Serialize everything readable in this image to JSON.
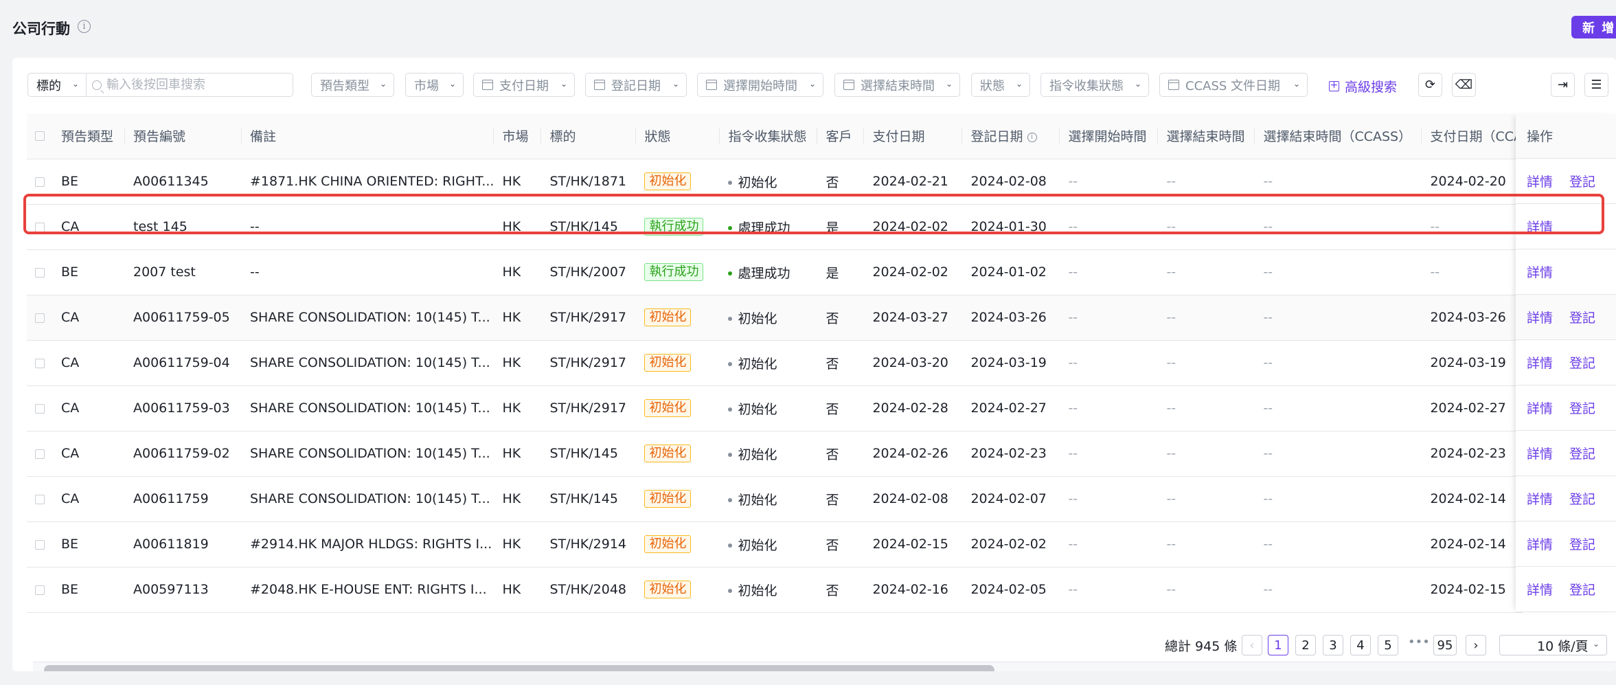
{
  "header": {
    "title": "公司行動",
    "new_button": "新 增"
  },
  "filters": {
    "target_select": "標的",
    "search_placeholder": "輸入後按回車搜索",
    "announce_type": "預告類型",
    "market": "市場",
    "pay_date": "支付日期",
    "record_date": "登記日期",
    "select_start": "選擇開始時間",
    "select_end": "選擇結束時間",
    "status": "狀態",
    "cmd_status": "指令收集狀態",
    "ccass_date": "CCASS 文件日期",
    "advanced_search": "高級搜索"
  },
  "table": {
    "headers": {
      "type": "預告類型",
      "code": "預告編號",
      "remark": "備註",
      "market": "市場",
      "target": "標的",
      "status": "狀態",
      "cmd_status": "指令收集狀態",
      "client": "客戶",
      "pay_date": "支付日期",
      "record_date": "登記日期",
      "select_start": "選擇開始時間",
      "select_end": "選擇結束時間",
      "select_end_ccass": "選擇結束時間（CCASS）",
      "pay_date2": "支付日期（CCA",
      "ops": "操作"
    },
    "rows": [
      {
        "type": "BE",
        "code": "A00611345",
        "remark": "#1871.HK CHINA ORIENTED: RIGHT...",
        "market": "HK",
        "target": "ST/HK/1871",
        "status": "初始化",
        "cmd": "初始化",
        "client": "否",
        "pay": "2024-02-21",
        "record": "2024-02-08",
        "start": "--",
        "end": "--",
        "end_ccass": "--",
        "pay2": "2024-02-20",
        "op1": "詳情",
        "op2": "登記"
      },
      {
        "type": "CA",
        "code": "test 145",
        "remark": "--",
        "market": "HK",
        "target": "ST/HK/145",
        "status": "執行成功",
        "cmd": "處理成功",
        "client": "是",
        "pay": "2024-02-02",
        "record": "2024-01-30",
        "start": "--",
        "end": "--",
        "end_ccass": "--",
        "pay2": "--",
        "op1": "詳情",
        "op2": ""
      },
      {
        "type": "BE",
        "code": "2007 test",
        "remark": "--",
        "market": "HK",
        "target": "ST/HK/2007",
        "status": "執行成功",
        "cmd": "處理成功",
        "client": "是",
        "pay": "2024-02-02",
        "record": "2024-01-02",
        "start": "--",
        "end": "--",
        "end_ccass": "--",
        "pay2": "--",
        "op1": "詳情",
        "op2": ""
      },
      {
        "type": "CA",
        "code": "A00611759-05",
        "remark": "SHARE CONSOLIDATION: 10(145) T...",
        "market": "HK",
        "target": "ST/HK/2917",
        "status": "初始化",
        "cmd": "初始化",
        "client": "否",
        "pay": "2024-03-27",
        "record": "2024-03-26",
        "start": "--",
        "end": "--",
        "end_ccass": "--",
        "pay2": "2024-03-26",
        "op1": "詳情",
        "op2": "登記"
      },
      {
        "type": "CA",
        "code": "A00611759-04",
        "remark": "SHARE CONSOLIDATION: 10(145) T...",
        "market": "HK",
        "target": "ST/HK/2917",
        "status": "初始化",
        "cmd": "初始化",
        "client": "否",
        "pay": "2024-03-20",
        "record": "2024-03-19",
        "start": "--",
        "end": "--",
        "end_ccass": "--",
        "pay2": "2024-03-19",
        "op1": "詳情",
        "op2": "登記"
      },
      {
        "type": "CA",
        "code": "A00611759-03",
        "remark": "SHARE CONSOLIDATION: 10(145) T...",
        "market": "HK",
        "target": "ST/HK/2917",
        "status": "初始化",
        "cmd": "初始化",
        "client": "否",
        "pay": "2024-02-28",
        "record": "2024-02-27",
        "start": "--",
        "end": "--",
        "end_ccass": "--",
        "pay2": "2024-02-27",
        "op1": "詳情",
        "op2": "登記"
      },
      {
        "type": "CA",
        "code": "A00611759-02",
        "remark": "SHARE CONSOLIDATION: 10(145) T...",
        "market": "HK",
        "target": "ST/HK/145",
        "status": "初始化",
        "cmd": "初始化",
        "client": "否",
        "pay": "2024-02-26",
        "record": "2024-02-23",
        "start": "--",
        "end": "--",
        "end_ccass": "--",
        "pay2": "2024-02-23",
        "op1": "詳情",
        "op2": "登記"
      },
      {
        "type": "CA",
        "code": "A00611759",
        "remark": "SHARE CONSOLIDATION: 10(145) T...",
        "market": "HK",
        "target": "ST/HK/145",
        "status": "初始化",
        "cmd": "初始化",
        "client": "否",
        "pay": "2024-02-08",
        "record": "2024-02-07",
        "start": "--",
        "end": "--",
        "end_ccass": "--",
        "pay2": "2024-02-14",
        "op1": "詳情",
        "op2": "登記"
      },
      {
        "type": "BE",
        "code": "A00611819",
        "remark": "#2914.HK MAJOR HLDGS: RIGHTS I...",
        "market": "HK",
        "target": "ST/HK/2914",
        "status": "初始化",
        "cmd": "初始化",
        "client": "否",
        "pay": "2024-02-15",
        "record": "2024-02-02",
        "start": "--",
        "end": "--",
        "end_ccass": "--",
        "pay2": "2024-02-14",
        "op1": "詳情",
        "op2": "登記"
      },
      {
        "type": "BE",
        "code": "A00597113",
        "remark": "#2048.HK E-HOUSE ENT: RIGHTS I...",
        "market": "HK",
        "target": "ST/HK/2048",
        "status": "初始化",
        "cmd": "初始化",
        "client": "否",
        "pay": "2024-02-16",
        "record": "2024-02-05",
        "start": "--",
        "end": "--",
        "end_ccass": "--",
        "pay2": "2024-02-15",
        "op1": "詳情",
        "op2": "登記"
      }
    ]
  },
  "pagination": {
    "total": "總計 945 條",
    "pages": [
      "1",
      "2",
      "3",
      "4",
      "5"
    ],
    "ellipsis": "•••",
    "last_page": "95",
    "page_size": "10 條/頁"
  },
  "colors": {
    "accent": "#6b3de8",
    "highlight": "#e8413c",
    "init": "#e8650a",
    "success": "#2ba11b"
  }
}
